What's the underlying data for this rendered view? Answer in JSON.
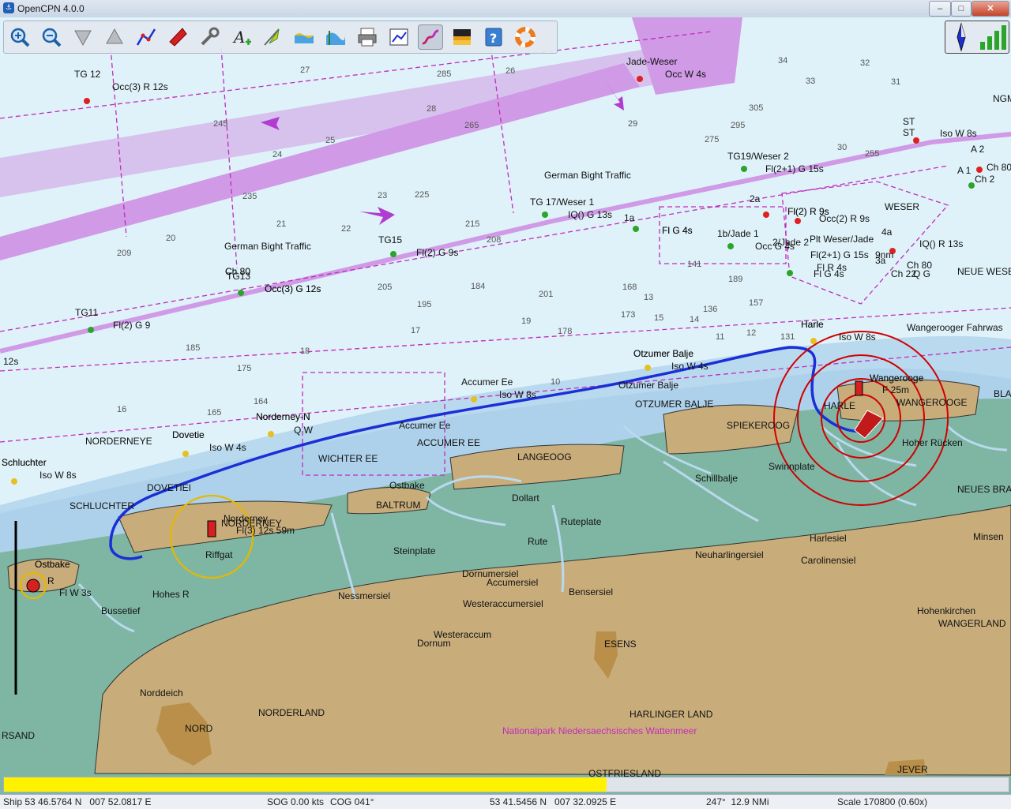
{
  "window": {
    "title": "OpenCPN 4.0.0",
    "app_icon": "opencpn-app-icon",
    "controls": {
      "minimize": "–",
      "maximize": "□",
      "close": "✕"
    }
  },
  "toolbar": {
    "tools": [
      {
        "name": "zoom-in-icon"
      },
      {
        "name": "zoom-out-icon"
      },
      {
        "name": "scale-in-icon"
      },
      {
        "name": "scale-out-icon"
      },
      {
        "name": "route-icon"
      },
      {
        "name": "follow-ship-icon"
      },
      {
        "name": "settings-wrench-icon"
      },
      {
        "name": "text-toggle-icon"
      },
      {
        "name": "current-icon"
      },
      {
        "name": "tide-icon"
      },
      {
        "name": "tide-graph-icon"
      },
      {
        "name": "print-icon"
      },
      {
        "name": "route-manager-icon"
      },
      {
        "name": "track-icon"
      },
      {
        "name": "color-scheme-icon"
      },
      {
        "name": "help-icon"
      },
      {
        "name": "mob-icon"
      }
    ],
    "active_tool": "track-icon"
  },
  "compass": {
    "icons": [
      "compass-rose-icon",
      "gps-signal-icon"
    ]
  },
  "colors": {
    "deep_water": "#dff2f9",
    "shallow_water": "#b7d8ee",
    "drying": "#7db4a2",
    "land": "#c8ad7b",
    "route": "#1b2fd6",
    "tss": "#d09ae6",
    "magenta": "#c22bbb"
  },
  "chart": {
    "place_labels": [
      "NORDERNEYE",
      "SCHLUCHTER",
      "DOVETIEI",
      "NORDERNEY",
      "BALTRUM",
      "WICHTER EE",
      "ACCUMER EE",
      "LANGEOOG",
      "OTZUMER BALJE",
      "SPIEKEROOG",
      "HARLE",
      "WANGEROOGE",
      "Hohes R",
      "Ostbake",
      "Steinplate",
      "Riffgat",
      "Dollart",
      "Ruteplate",
      "Rute",
      "Schillbalje",
      "Swinnplate",
      "Hoher Rücken",
      "Neuharlingersiel",
      "Harlesiel",
      "Carolinensiel",
      "Minsen",
      "Bensersiel",
      "Dornumersiel",
      "Accumersiel",
      "Westeraccumersiel",
      "Nessmersiel",
      "Westeraccum",
      "Dornum",
      "ESENS",
      "Hohenkirchen",
      "WANGERLAND",
      "Norddeich",
      "NORDERLAND",
      "NORD",
      "HARLINGER LAND",
      "OSTFRIESLAND",
      "JEVER",
      "NEUES BRA",
      "NEUE WESE",
      "WESER",
      "Bussetief",
      "RSAND",
      "Schluchter",
      "Ostbake",
      "Dovetie",
      "Norderney-N",
      "Accumer Ee",
      "Otzumer Balje",
      "Otzumer Balje",
      "Harle",
      "Wangerooge",
      "Wangerooger Fahrwas",
      "German Bight Traffic",
      "German Bight Traffic",
      "NGM",
      "BLA",
      "ST"
    ],
    "buoys": [
      {
        "name": "TG 12",
        "light": "Occ(3) R 12s"
      },
      {
        "name": "Jade-Weser",
        "light": "Occ W 4s"
      },
      {
        "name": "TG19/Weser 2",
        "light": "Fl(2+1) G 15s"
      },
      {
        "name": "TG 17/Weser 1",
        "light": "IQ() G 13s"
      },
      {
        "name": "TG15",
        "light": "Fl(2) G 9s"
      },
      {
        "name": "TG13",
        "light": "Occ(3) G 12s"
      },
      {
        "name": "TG11",
        "light": "Fl(2) G 9"
      },
      {
        "name": "1a",
        "light": "Fl G 4s"
      },
      {
        "name": "1b/Jade 1",
        "light": "Occ G 4s"
      },
      {
        "name": "2/Jade 2",
        "light": "Fl(2) R 9s"
      },
      {
        "name": "2a",
        "light": "Occ(2) R 9s"
      },
      {
        "name": "4a",
        "light": "IQ() R 13s"
      },
      {
        "name": "3a",
        "light": "Fl(2+1) G 15s"
      },
      {
        "name": "Plt Weser/Jade",
        "light": "Fl R 4s"
      },
      {
        "name": "Ch 80",
        "light": "Q G"
      },
      {
        "name": "Ch 22",
        "light": "Fl G 4s"
      },
      {
        "name": "ST",
        "light": "Iso W 8s"
      },
      {
        "name": "A 2",
        "light": "Ch 80"
      },
      {
        "name": "A 1",
        "light": "Ch 2"
      },
      {
        "name": "Harle",
        "light": "Iso W 8s"
      },
      {
        "name": "Otzumer Balje",
        "light": "Iso W 4s"
      },
      {
        "name": "Accumer Ee",
        "light": "Iso W 8s"
      },
      {
        "name": "Dovetie",
        "light": "Iso W 4s"
      },
      {
        "name": "Schluchter",
        "light": "Iso W 8s"
      },
      {
        "name": "Norderney-N",
        "light": "Q W"
      },
      {
        "name": "Ch 80",
        "light": "Occ(3) G 12s"
      }
    ],
    "lighthouses": [
      {
        "name": "Norderney",
        "light": "Fl(3) 12s 59m"
      },
      {
        "name": "Wangerooge",
        "light": "F 25m"
      },
      {
        "name": "Ostbake",
        "light": "Fl W 3s"
      }
    ],
    "misc_text": [
      "12s",
      "9nm",
      "R",
      "Fl G 4s",
      "Nationalpark Niedersaechsisches Wattenmeer",
      "Fl(2) R 9s",
      "Ch 80"
    ],
    "soundings": [
      "27",
      "285",
      "26",
      "265",
      "28",
      "24",
      "25",
      "245",
      "23",
      "235",
      "22",
      "225",
      "21",
      "215",
      "20",
      "205",
      "19",
      "195",
      "18",
      "185",
      "17",
      "175",
      "16",
      "165",
      "15",
      "14",
      "13",
      "12",
      "11",
      "10",
      "34",
      "33",
      "32",
      "31",
      "305",
      "29",
      "295",
      "30",
      "275",
      "255",
      "209",
      "208",
      "201",
      "189",
      "184",
      "178",
      "173",
      "168",
      "164",
      "157",
      "141",
      "136",
      "131"
    ]
  },
  "progress": {
    "fraction": 0.6
  },
  "status": {
    "ship": "Ship 53 46.5764 N   007 52.0817 E",
    "sog": "SOG 0.00 kts",
    "cog": "COG 041°",
    "cursor": "53 41.5456 N   007 32.0925 E",
    "bearing": "247°  12.9 NMi",
    "scale": "Scale 170800 (0.60x)"
  }
}
